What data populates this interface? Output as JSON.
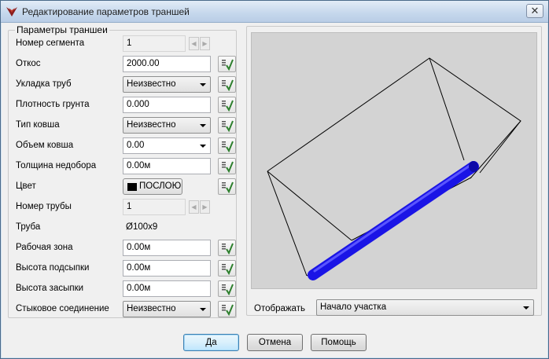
{
  "window": {
    "title": "Редактирование параметров траншей",
    "close_glyph": "✕",
    "app_icon": "wedge-logo-icon"
  },
  "params": {
    "group_title": "Параметры траншеи",
    "segment_number": {
      "label": "Номер сегмента",
      "value": "1"
    },
    "slope": {
      "label": "Откос",
      "value": "2000.00"
    },
    "pipe_laying": {
      "label": "Укладка труб",
      "value": "Неизвестно"
    },
    "soil_density": {
      "label": "Плотность грунта",
      "value": "0.000"
    },
    "bucket_type": {
      "label": "Тип ковша",
      "value": "Неизвестно"
    },
    "bucket_volume": {
      "label": "Объем ковша",
      "value": "0.00"
    },
    "shortfall_thickness": {
      "label": "Толщина недобора",
      "value": "0.00м"
    },
    "color": {
      "label": "Цвет",
      "value": "ПОСЛОЮ",
      "swatch": "#000000"
    },
    "pipe_number": {
      "label": "Номер трубы",
      "value": "1"
    },
    "pipe": {
      "label": "Труба",
      "value": "Ø100x9"
    },
    "work_zone": {
      "label": "Рабочая зона",
      "value": "0.00м"
    },
    "bedding_height": {
      "label": "Высота подсыпки",
      "value": "0.00м"
    },
    "backfill_height": {
      "label": "Высота засыпки",
      "value": "0.00м"
    },
    "butt_joint": {
      "label": "Стыковое соединение",
      "value": "Неизвестно"
    },
    "pick_icon": "pick-from-drawing-icon"
  },
  "preview": {
    "display_label": "Отображать",
    "display_value": "Начало участка",
    "background": "#d3d3d3",
    "pipe_color": "#1a14e6"
  },
  "buttons": {
    "ok": "Да",
    "cancel": "Отмена",
    "help": "Помощь"
  }
}
